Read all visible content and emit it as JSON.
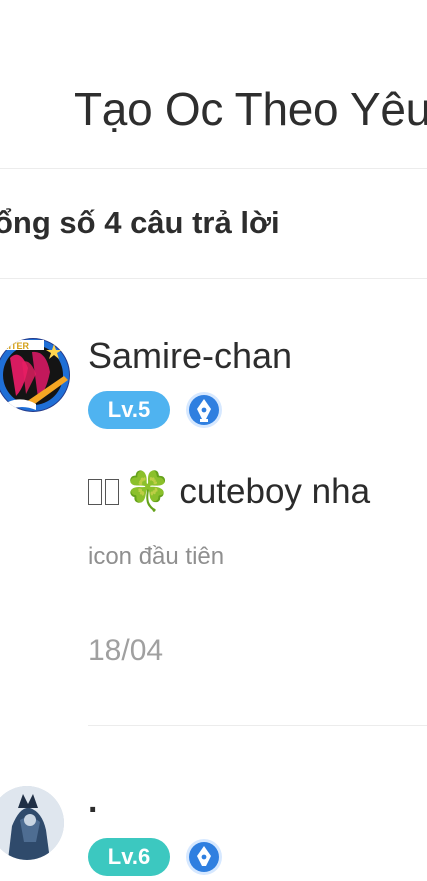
{
  "header": {
    "title": "Tạo Oc Theo Yêu"
  },
  "answers_count": "ổng số 4 câu trả lời",
  "answers": [
    {
      "username": "Samire-chan",
      "level": "Lv.5",
      "level_color": "#4fb3f0",
      "avatar_icon": "writer-avatar",
      "role_icon": "pen-nib-icon",
      "text": "cuteboy nha",
      "emoji": "🍀",
      "note": "icon đầu tiên",
      "date": "18/04"
    },
    {
      "username": ".",
      "level": "Lv.6",
      "level_color": "#3cc8c0",
      "avatar_icon": "knight-avatar",
      "role_icon": "pen-nib-icon"
    }
  ]
}
